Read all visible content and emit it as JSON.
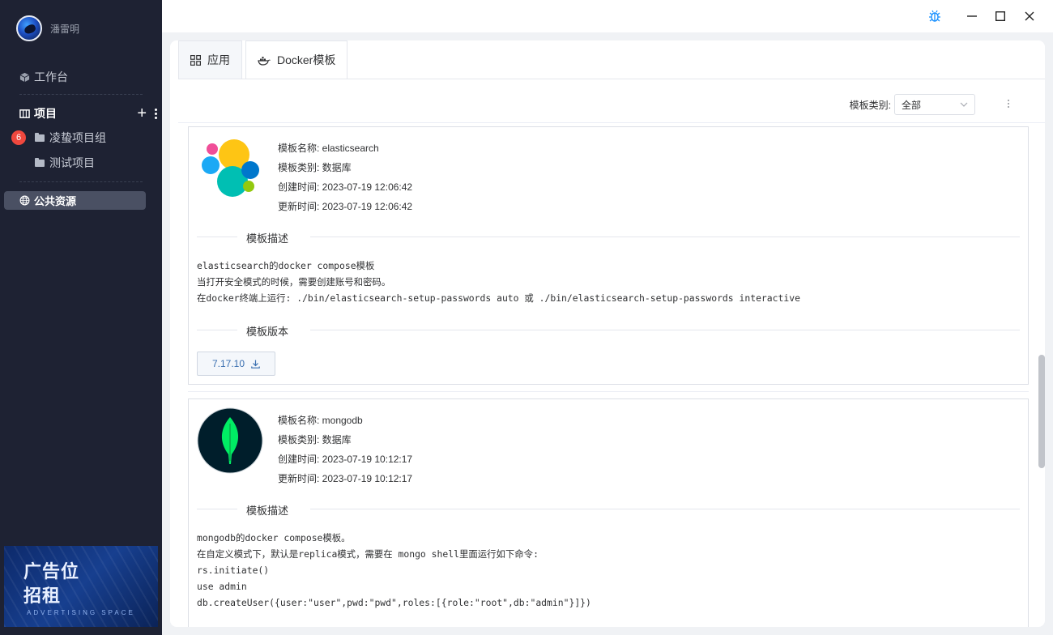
{
  "sidebar": {
    "user_name": "潘雷明",
    "workbench": "工作台",
    "projects_label": "项目",
    "badge_count": "6",
    "groups": [
      "凌蛰项目组",
      "测试项目"
    ],
    "public_resources": "公共资源",
    "ad": {
      "line1": "广告位",
      "line2": "招租",
      "sub": "ADVERTISING SPACE"
    }
  },
  "tabs": [
    {
      "label": "应用",
      "icon": "grid-icon"
    },
    {
      "label": "Docker模板",
      "icon": "docker-icon"
    }
  ],
  "filter": {
    "label": "模板类别:",
    "value": "全部"
  },
  "templates": [
    {
      "name_line": "模板名称: elasticsearch",
      "category_line": "模板类别: 数据库",
      "created_line": "创建时间: 2023-07-19 12:06:42",
      "updated_line": "更新时间: 2023-07-19 12:06:42",
      "desc_title": "模板描述",
      "desc_lines": [
        "elasticsearch的docker compose模板",
        "当打开安全模式的时候，需要创建账号和密码。",
        "在docker终端上运行: ./bin/elasticsearch-setup-passwords auto 或 ./bin/elasticsearch-setup-passwords interactive"
      ],
      "version_title": "模板版本",
      "versions": [
        "7.17.10"
      ]
    },
    {
      "name_line": "模板名称: mongodb",
      "category_line": "模板类别: 数据库",
      "created_line": "创建时间: 2023-07-19 10:12:17",
      "updated_line": "更新时间: 2023-07-19 10:12:17",
      "desc_title": "模板描述",
      "desc_lines": [
        "mongodb的docker compose模板。",
        "在自定义模式下，默认是replica模式，需要在 mongo shell里面运行如下命令:",
        "rs.initiate()",
        "use admin",
        "db.createUser({user:\"user\",pwd:\"pwd\",roles:[{role:\"root\",db:\"admin\"}]})"
      ]
    }
  ],
  "colors": {
    "sidebar_bg": "#1e2233",
    "accent": "#3a6fb0",
    "badge": "#f0483e",
    "bug_icon": "#1890ff"
  }
}
